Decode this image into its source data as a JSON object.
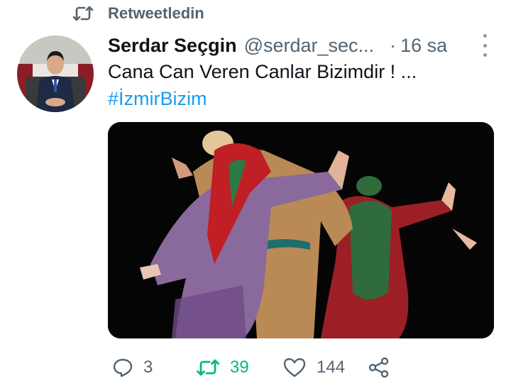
{
  "retweet_banner": {
    "label": "Retweetledin",
    "icon": "retweet-icon"
  },
  "author": {
    "display_name": "Serdar Seçgin",
    "handle": "@serdar_sec...",
    "separator": "·",
    "time": "16 sa"
  },
  "tweet": {
    "text": "Cana Can Veren Canlar Bizimdir ! ...",
    "hashtag": "#İzmirBizim"
  },
  "actions": {
    "replies": "3",
    "retweets": "39",
    "likes": "144"
  },
  "colors": {
    "accent": "#1d9bf0",
    "retweet_active": "#00ba7c",
    "muted": "#536471"
  }
}
